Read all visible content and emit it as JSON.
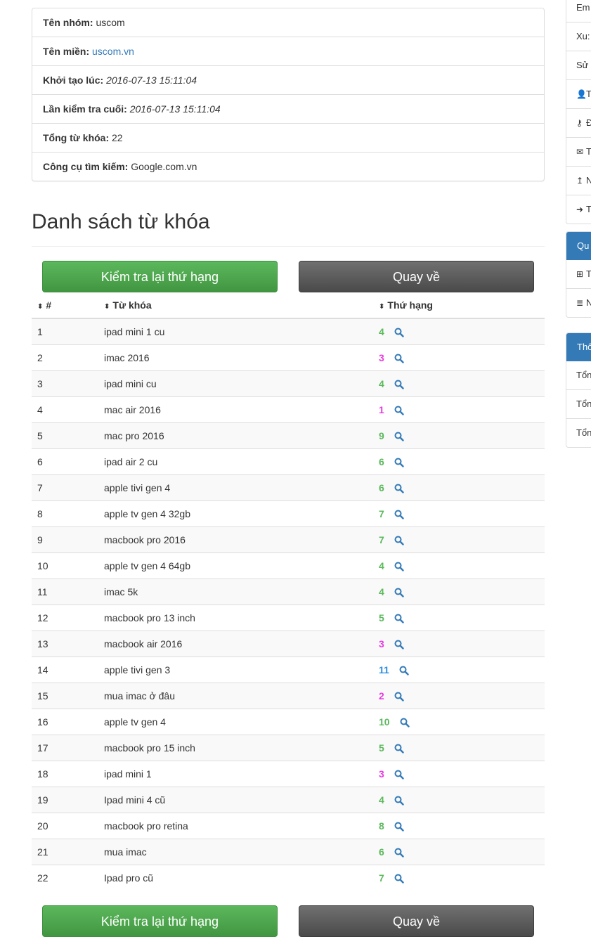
{
  "info": {
    "group_label": "Tên nhóm:",
    "group_value": "uscom",
    "domain_label": "Tên miền:",
    "domain_value": "uscom.vn",
    "created_label": "Khởi tạo lúc:",
    "created_value": "2016-07-13 15:11:04",
    "lastcheck_label": "Lần kiểm tra cuối:",
    "lastcheck_value": "2016-07-13 15:11:04",
    "total_label": "Tổng từ khóa:",
    "total_value": "22",
    "engine_label": "Công cụ tìm kiếm:",
    "engine_value": "Google.com.vn"
  },
  "section_title": "Danh sách từ khóa",
  "buttons": {
    "recheck": "Kiểm tra lại thứ hạng",
    "back": "Quay về"
  },
  "table": {
    "headers": [
      "#",
      "Từ khóa",
      "Thứ hạng"
    ],
    "rows": [
      {
        "num": "1",
        "keyword": "ipad mini 1 cu",
        "rank": "4",
        "color": "#5cb85c"
      },
      {
        "num": "2",
        "keyword": "imac 2016",
        "rank": "3",
        "color": "#e83ae0"
      },
      {
        "num": "3",
        "keyword": "ipad mini cu",
        "rank": "4",
        "color": "#5cb85c"
      },
      {
        "num": "4",
        "keyword": "mac air 2016",
        "rank": "1",
        "color": "#e83ae0"
      },
      {
        "num": "5",
        "keyword": "mac pro 2016",
        "rank": "9",
        "color": "#5cb85c"
      },
      {
        "num": "6",
        "keyword": "ipad air 2 cu",
        "rank": "6",
        "color": "#5cb85c"
      },
      {
        "num": "7",
        "keyword": "apple tivi gen 4",
        "rank": "6",
        "color": "#5cb85c"
      },
      {
        "num": "8",
        "keyword": "apple tv gen 4 32gb",
        "rank": "7",
        "color": "#5cb85c"
      },
      {
        "num": "9",
        "keyword": "macbook pro 2016",
        "rank": "7",
        "color": "#5cb85c"
      },
      {
        "num": "10",
        "keyword": "apple tv gen 4 64gb",
        "rank": "4",
        "color": "#5cb85c"
      },
      {
        "num": "11",
        "keyword": "imac 5k",
        "rank": "4",
        "color": "#5cb85c"
      },
      {
        "num": "12",
        "keyword": "macbook pro 13 inch",
        "rank": "5",
        "color": "#5cb85c"
      },
      {
        "num": "13",
        "keyword": "macbook air 2016",
        "rank": "3",
        "color": "#e83ae0"
      },
      {
        "num": "14",
        "keyword": "apple tivi gen 3",
        "rank": "11",
        "color": "#2a8fe0"
      },
      {
        "num": "15",
        "keyword": "mua imac ở đâu",
        "rank": "2",
        "color": "#e83ae0"
      },
      {
        "num": "16",
        "keyword": "apple tv gen 4",
        "rank": "10",
        "color": "#5cb85c"
      },
      {
        "num": "17",
        "keyword": "macbook pro 15 inch",
        "rank": "5",
        "color": "#5cb85c"
      },
      {
        "num": "18",
        "keyword": "ipad mini 1",
        "rank": "3",
        "color": "#e83ae0"
      },
      {
        "num": "19",
        "keyword": "Ipad mini 4 cũ",
        "rank": "4",
        "color": "#5cb85c"
      },
      {
        "num": "20",
        "keyword": "macbook pro retina",
        "rank": "8",
        "color": "#5cb85c"
      },
      {
        "num": "21",
        "keyword": "mua imac",
        "rank": "6",
        "color": "#5cb85c"
      },
      {
        "num": "22",
        "keyword": "Ipad pro cũ",
        "rank": "7",
        "color": "#5cb85c"
      }
    ]
  },
  "sidebar": {
    "account_items": [
      {
        "label": "Em",
        "icon": ""
      },
      {
        "label": "Xu:",
        "icon": ""
      },
      {
        "label": "Sử d",
        "icon": ""
      },
      {
        "label": "T",
        "icon": "user-icon"
      },
      {
        "label": "Đ",
        "icon": "key-icon"
      },
      {
        "label": "T",
        "icon": "envelope-icon"
      },
      {
        "label": "N",
        "icon": "upload-icon"
      },
      {
        "label": "T",
        "icon": "sign-out-icon"
      }
    ],
    "manage_title": "Qu",
    "manage_items": [
      {
        "label": "T",
        "icon": "plus-square-icon"
      },
      {
        "label": "N",
        "icon": "database-icon"
      }
    ],
    "stats_title": "Thô",
    "stats_items": [
      "Tổn",
      "Tổn",
      "Tổn"
    ]
  },
  "colors": {
    "rank_green": "#5cb85c",
    "rank_magenta": "#e83ae0",
    "rank_blue": "#2a8fe0",
    "link": "#337ab7",
    "panel_head": "#337ab7"
  }
}
